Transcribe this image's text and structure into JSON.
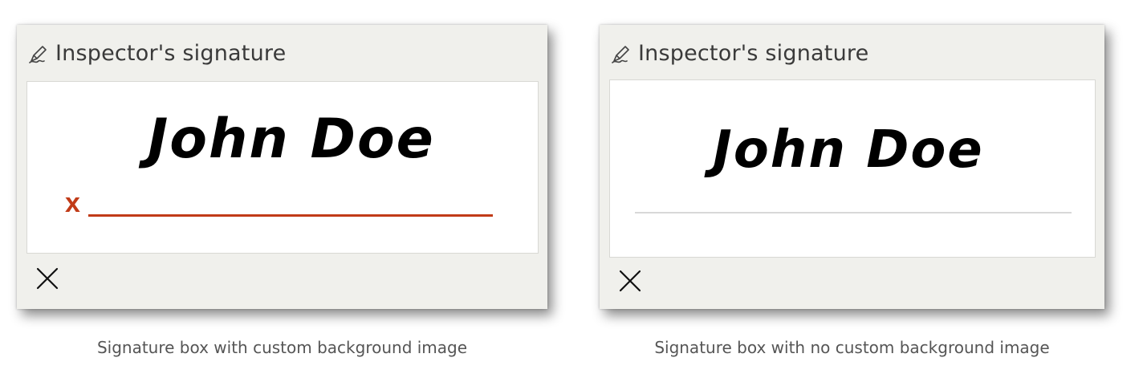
{
  "left_panel": {
    "header_label": "Inspector's signature",
    "signature_text": "John Doe",
    "line_marker": "x",
    "caption": "Signature box with custom background image"
  },
  "right_panel": {
    "header_label": "Inspector's signature",
    "signature_text": "John Doe",
    "caption": "Signature box with no custom background image"
  },
  "icons": {
    "header": "signature-pen-icon",
    "clear": "close-icon"
  },
  "colors": {
    "panel_bg": "#f0f0ec",
    "accent_line": "#c13b18",
    "neutral_line": "#d8d8d8"
  }
}
